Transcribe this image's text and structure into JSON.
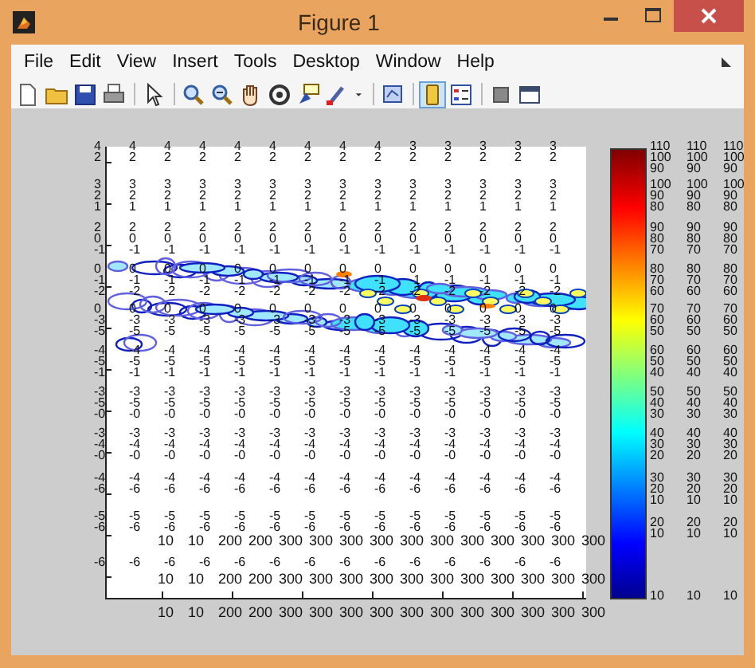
{
  "window": {
    "title": "Figure 1"
  },
  "menu": [
    {
      "label": "File"
    },
    {
      "label": "Edit"
    },
    {
      "label": "View"
    },
    {
      "label": "Insert"
    },
    {
      "label": "Tools"
    },
    {
      "label": "Desktop"
    },
    {
      "label": "Window"
    },
    {
      "label": "Help"
    }
  ],
  "toolbar": [
    {
      "kind": "new"
    },
    {
      "kind": "open"
    },
    {
      "kind": "save"
    },
    {
      "kind": "print"
    },
    {
      "kind": "separator"
    },
    {
      "kind": "pointer"
    },
    {
      "kind": "separator"
    },
    {
      "kind": "zoom-in"
    },
    {
      "kind": "zoom-out"
    },
    {
      "kind": "pan"
    },
    {
      "kind": "rotate"
    },
    {
      "kind": "data-cursor"
    },
    {
      "kind": "brush"
    },
    {
      "kind": "dropdown"
    },
    {
      "kind": "separator"
    },
    {
      "kind": "link"
    },
    {
      "kind": "separator"
    },
    {
      "kind": "colorbar",
      "selected": true
    },
    {
      "kind": "legend",
      "selected": false
    },
    {
      "kind": "separator"
    },
    {
      "kind": "hide"
    },
    {
      "kind": "dock"
    }
  ],
  "plot": {
    "label_rows": [
      {
        "stacks": [
          [
            "4",
            "2"
          ],
          [
            "4",
            "2"
          ],
          [
            "4",
            "2"
          ],
          [
            "4",
            "2"
          ],
          [
            "4",
            "2"
          ],
          [
            "4",
            "2"
          ],
          [
            "4",
            "2"
          ],
          [
            "4",
            "2"
          ],
          [
            "4",
            "2"
          ],
          [
            "3",
            "2"
          ],
          [
            "3",
            "2"
          ],
          [
            "3",
            "2"
          ],
          [
            "3",
            "2"
          ],
          [
            "3",
            "2"
          ]
        ]
      },
      {
        "stacks": [
          [
            "3",
            "2",
            "1"
          ],
          [
            "3",
            "2",
            "1"
          ],
          [
            "3",
            "2",
            "1"
          ],
          [
            "3",
            "2",
            "1"
          ],
          [
            "3",
            "2",
            "1"
          ],
          [
            "3",
            "2",
            "1"
          ],
          [
            "3",
            "2",
            "1"
          ],
          [
            "3",
            "2",
            "1"
          ],
          [
            "3",
            "2",
            "1"
          ],
          [
            "3",
            "2",
            "1"
          ],
          [
            "3",
            "2",
            "1"
          ],
          [
            "3",
            "2",
            "1"
          ],
          [
            "3",
            "2",
            "1"
          ],
          [
            "3",
            "2",
            "1"
          ]
        ]
      },
      {
        "stacks": [
          [
            "2",
            "0",
            "-1"
          ],
          [
            "2",
            "0",
            "-1"
          ],
          [
            "2",
            "0",
            "-1"
          ],
          [
            "2",
            "0",
            "-1"
          ],
          [
            "2",
            "0",
            "-1"
          ],
          [
            "2",
            "0",
            "-1"
          ],
          [
            "2",
            "0",
            "-1"
          ],
          [
            "2",
            "0",
            "-1"
          ],
          [
            "2",
            "0",
            "-1"
          ],
          [
            "2",
            "0",
            "-1"
          ],
          [
            "2",
            "0",
            "-1"
          ],
          [
            "2",
            "0",
            "-1"
          ],
          [
            "2",
            "0",
            "-1"
          ],
          [
            "2",
            "0",
            "-1"
          ]
        ]
      },
      {
        "stacks": [
          [
            "0",
            "-1",
            "-2"
          ],
          [
            "0",
            "-1",
            "-2"
          ],
          [
            "0",
            "-1",
            "-2"
          ],
          [
            "0",
            "-1",
            "-2"
          ],
          [
            "0",
            "-1",
            "-2"
          ],
          [
            "0",
            "-1",
            "-2"
          ],
          [
            "0",
            "-1",
            "-2"
          ],
          [
            "0",
            "-1",
            "-2"
          ],
          [
            "0",
            "-1",
            "-2"
          ],
          [
            "0",
            "-1",
            "-2"
          ],
          [
            "0",
            "-1",
            "-2"
          ],
          [
            "0",
            "-1",
            "-2"
          ],
          [
            "0",
            "-1",
            "-2"
          ],
          [
            "0",
            "-1",
            "-2"
          ]
        ]
      },
      {
        "stacks": [
          [
            "0",
            "-3",
            "-5"
          ],
          [
            "0",
            "-3",
            "-5"
          ],
          [
            "0",
            "-3",
            "-5"
          ],
          [
            "0",
            "-3",
            "-5"
          ],
          [
            "0",
            "-3",
            "-5"
          ],
          [
            "0",
            "-3",
            "-5"
          ],
          [
            "0",
            "-3",
            "-5"
          ],
          [
            "0",
            "-3",
            "-5"
          ],
          [
            "0",
            "-3",
            "-5"
          ],
          [
            "0",
            "-3",
            "-5"
          ],
          [
            "0",
            "-3",
            "-5"
          ],
          [
            "0",
            "-3",
            "-5"
          ],
          [
            "0",
            "-3",
            "-5"
          ],
          [
            "0",
            "-3",
            "-5"
          ]
        ]
      },
      {
        "stacks": [
          [
            "-4",
            "-5",
            "-1"
          ],
          [
            "-4",
            "-5",
            "-1"
          ],
          [
            "-4",
            "-5",
            "-1"
          ],
          [
            "-4",
            "-5",
            "-1"
          ],
          [
            "-4",
            "-5",
            "-1"
          ],
          [
            "-4",
            "-5",
            "-1"
          ],
          [
            "-4",
            "-5",
            "-1"
          ],
          [
            "-4",
            "-5",
            "-1"
          ],
          [
            "-4",
            "-5",
            "-1"
          ],
          [
            "-4",
            "-5",
            "-1"
          ],
          [
            "-4",
            "-5",
            "-1"
          ],
          [
            "-4",
            "-5",
            "-1"
          ],
          [
            "-4",
            "-5",
            "-1"
          ],
          [
            "-4",
            "-5",
            "-1"
          ]
        ]
      },
      {
        "stacks": [
          [
            "-3",
            "-5",
            "-0"
          ],
          [
            "-3",
            "-5",
            "-0"
          ],
          [
            "-3",
            "-5",
            "-0"
          ],
          [
            "-3",
            "-5",
            "-0"
          ],
          [
            "-3",
            "-5",
            "-0"
          ],
          [
            "-3",
            "-5",
            "-0"
          ],
          [
            "-3",
            "-5",
            "-0"
          ],
          [
            "-3",
            "-5",
            "-0"
          ],
          [
            "-3",
            "-5",
            "-0"
          ],
          [
            "-3",
            "-5",
            "-0"
          ],
          [
            "-3",
            "-5",
            "-0"
          ],
          [
            "-3",
            "-5",
            "-0"
          ],
          [
            "-3",
            "-5",
            "-0"
          ],
          [
            "-3",
            "-5",
            "-0"
          ]
        ]
      },
      {
        "stacks": [
          [
            "-3",
            "-4",
            "-0"
          ],
          [
            "-3",
            "-4",
            "-0"
          ],
          [
            "-3",
            "-4",
            "-0"
          ],
          [
            "-3",
            "-4",
            "-0"
          ],
          [
            "-3",
            "-4",
            "-0"
          ],
          [
            "-3",
            "-4",
            "-0"
          ],
          [
            "-3",
            "-4",
            "-0"
          ],
          [
            "-3",
            "-4",
            "-0"
          ],
          [
            "-3",
            "-4",
            "-0"
          ],
          [
            "-3",
            "-4",
            "-0"
          ],
          [
            "-3",
            "-4",
            "-0"
          ],
          [
            "-3",
            "-4",
            "-0"
          ],
          [
            "-3",
            "-4",
            "-0"
          ],
          [
            "-3",
            "-4",
            "-0"
          ]
        ]
      },
      {
        "stacks": [
          [
            "-4",
            "-6"
          ],
          [
            "-4",
            "-6"
          ],
          [
            "-4",
            "-6"
          ],
          [
            "-4",
            "-6"
          ],
          [
            "-4",
            "-6"
          ],
          [
            "-4",
            "-6"
          ],
          [
            "-4",
            "-6"
          ],
          [
            "-4",
            "-6"
          ],
          [
            "-4",
            "-6"
          ],
          [
            "-4",
            "-6"
          ],
          [
            "-4",
            "-6"
          ],
          [
            "-4",
            "-6"
          ],
          [
            "-4",
            "-6"
          ],
          [
            "-4",
            "-6"
          ]
        ]
      },
      {
        "stacks": [
          [
            "-5",
            "-6"
          ],
          [
            "-5",
            "-6"
          ],
          [
            "-5",
            "-6"
          ],
          [
            "-5",
            "-6"
          ],
          [
            "-5",
            "-6"
          ],
          [
            "-5",
            "-6"
          ],
          [
            "-5",
            "-6"
          ],
          [
            "-5",
            "-6"
          ],
          [
            "-5",
            "-6"
          ],
          [
            "-5",
            "-6"
          ],
          [
            "-5",
            "-6"
          ],
          [
            "-5",
            "-6"
          ],
          [
            "-5",
            "-6"
          ],
          [
            "-5",
            "-6"
          ]
        ]
      },
      {
        "stacks": [
          [
            "-6"
          ],
          [
            "-6"
          ],
          [
            "-6"
          ],
          [
            "-6"
          ],
          [
            "-6"
          ],
          [
            "-6"
          ],
          [
            "-6"
          ],
          [
            "-6"
          ],
          [
            "-6"
          ],
          [
            "-6"
          ],
          [
            "-6"
          ],
          [
            "-6"
          ],
          [
            "-6"
          ],
          [
            "-6"
          ]
        ]
      }
    ],
    "x_label_rows": [
      {
        "labels": [
          "10",
          "10",
          "200",
          "200",
          "300",
          "300",
          "300",
          "300",
          "300",
          "300",
          "300",
          "300",
          "300",
          "300",
          "300"
        ]
      },
      {
        "labels": [
          "10",
          "10",
          "200",
          "200",
          "300",
          "300",
          "300",
          "300",
          "300",
          "300",
          "300",
          "300",
          "300",
          "300",
          "300"
        ]
      },
      {
        "labels": [
          "10",
          "10",
          "200",
          "200",
          "300",
          "300",
          "300",
          "300",
          "300",
          "300",
          "300",
          "300",
          "300",
          "300",
          "300"
        ]
      }
    ],
    "colorbar_rows": [
      {
        "stacks": [
          [
            "110",
            "100",
            "90"
          ],
          [
            "110",
            "100",
            "90"
          ],
          [
            "110",
            "100",
            "90"
          ]
        ]
      },
      {
        "stacks": [
          [
            "100",
            "90",
            "80"
          ],
          [
            "100",
            "90",
            "80"
          ],
          [
            "100",
            "90",
            "80"
          ]
        ]
      },
      {
        "stacks": [
          [
            "90",
            "80",
            "70"
          ],
          [
            "90",
            "80",
            "70"
          ],
          [
            "90",
            "80",
            "70"
          ]
        ]
      },
      {
        "stacks": [
          [
            "80",
            "70",
            "60"
          ],
          [
            "80",
            "70",
            "60"
          ],
          [
            "80",
            "70",
            "60"
          ]
        ]
      },
      {
        "stacks": [
          [
            "70",
            "60",
            "50"
          ],
          [
            "70",
            "60",
            "50"
          ],
          [
            "70",
            "60",
            "50"
          ]
        ]
      },
      {
        "stacks": [
          [
            "60",
            "50",
            "40"
          ],
          [
            "60",
            "50",
            "40"
          ],
          [
            "60",
            "50",
            "40"
          ]
        ]
      },
      {
        "stacks": [
          [
            "50",
            "40",
            "30"
          ],
          [
            "50",
            "40",
            "30"
          ],
          [
            "50",
            "40",
            "30"
          ]
        ]
      },
      {
        "stacks": [
          [
            "40",
            "30",
            "20"
          ],
          [
            "40",
            "30",
            "20"
          ],
          [
            "40",
            "30",
            "20"
          ]
        ]
      },
      {
        "stacks": [
          [
            "30",
            "20",
            "10"
          ],
          [
            "30",
            "20",
            "10"
          ],
          [
            "30",
            "20",
            "10"
          ]
        ]
      },
      {
        "stacks": [
          [
            "20",
            "10"
          ],
          [
            "20",
            "10"
          ],
          [
            "20",
            "10"
          ]
        ]
      },
      {
        "stacks": [
          [
            "10"
          ],
          [
            "10"
          ],
          [
            "10"
          ]
        ]
      }
    ]
  }
}
